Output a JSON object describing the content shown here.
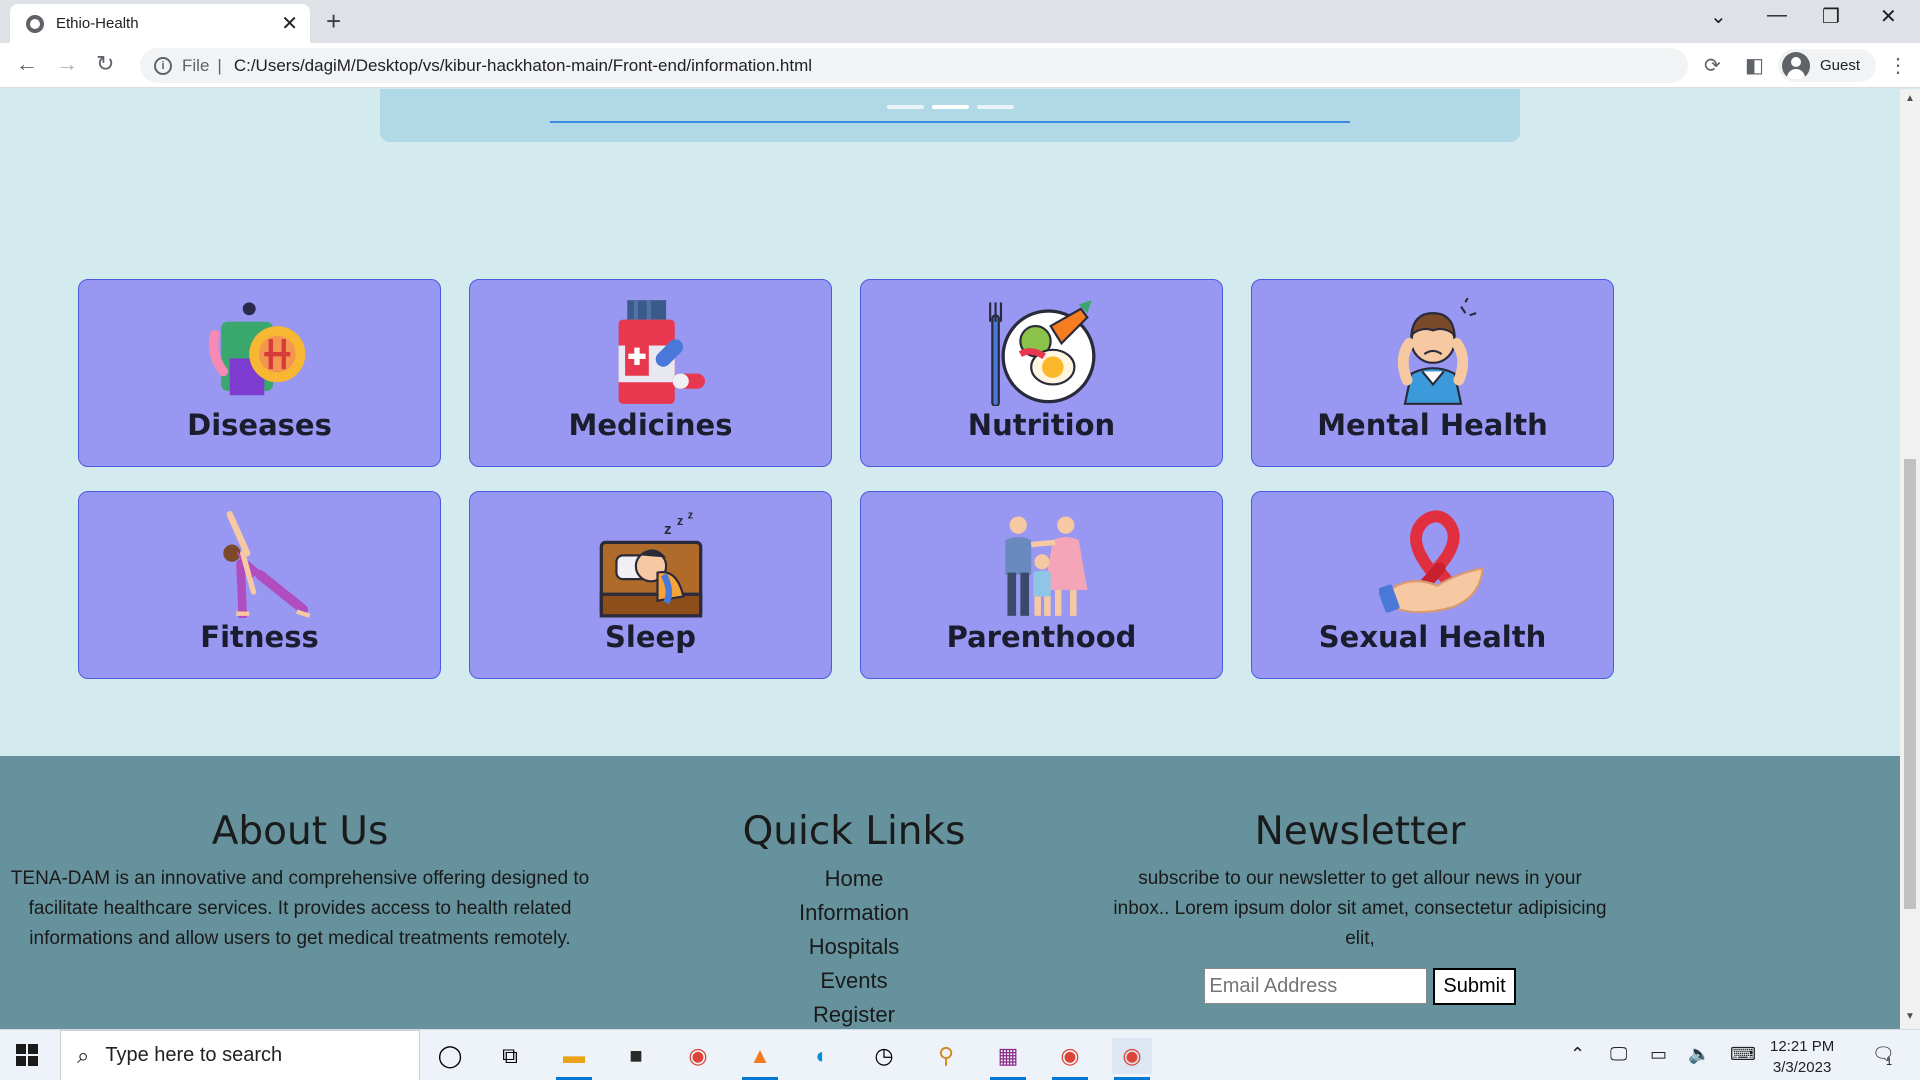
{
  "browser": {
    "tab_title": "Ethio-Health",
    "close_glyph": "✕",
    "new_tab_glyph": "+",
    "url_scheme": "File",
    "url_separator": "|",
    "url": "C:/Users/dagiM/Desktop/vs/kibur-hackhaton-main/Front-end/information.html",
    "profile_label": "Guest"
  },
  "categories": [
    {
      "label": "Diseases",
      "icon": "diseases-icon"
    },
    {
      "label": "Medicines",
      "icon": "medicines-icon"
    },
    {
      "label": "Nutrition",
      "icon": "nutrition-icon"
    },
    {
      "label": "Mental Health",
      "icon": "mental-health-icon"
    },
    {
      "label": "Fitness",
      "icon": "fitness-icon"
    },
    {
      "label": "Sleep",
      "icon": "sleep-icon"
    },
    {
      "label": "Parenthood",
      "icon": "parenthood-icon"
    },
    {
      "label": "Sexual Health",
      "icon": "sexual-health-icon"
    }
  ],
  "footer": {
    "about": {
      "title": "About Us",
      "text": "TENA-DAM is an innovative and comprehensive offering designed to facilitate healthcare services. It provides access to health related informations and allow users to get medical treatments remotely."
    },
    "quick_links": {
      "title": "Quick Links",
      "items": [
        "Home",
        "Information",
        "Hospitals",
        "Events",
        "Register"
      ]
    },
    "newsletter": {
      "title": "Newsletter",
      "text": "subscribe to our newsletter to get allour news in your inbox.. Lorem ipsum dolor sit amet, consectetur adipisicing elit,",
      "email_placeholder": "Email Address",
      "submit_label": "Submit"
    }
  },
  "taskbar": {
    "search_placeholder": "Type here to search",
    "time": "12:21 PM",
    "date": "3/3/2023",
    "notification_count": "1"
  },
  "colors": {
    "page_bg": "#d3ebef",
    "card_bg": "#9897f2",
    "card_border": "#4a5be0",
    "footer_bg": "#65929c"
  }
}
